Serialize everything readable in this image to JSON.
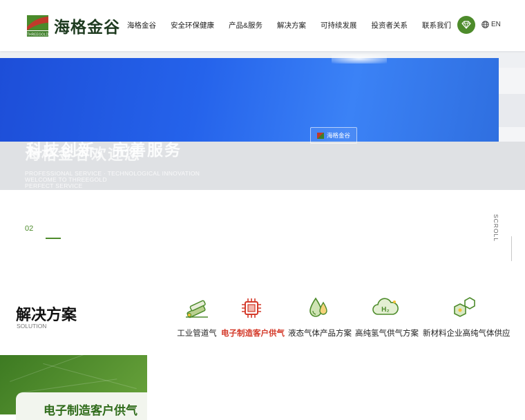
{
  "brand": {
    "name": "海格金谷",
    "logo_tagline": "THREEGOLD",
    "colors": {
      "primary_green": "#4d8b2b",
      "accent_red": "#d43a2a",
      "dark_text": "#1d3a1f"
    }
  },
  "nav": {
    "items": [
      {
        "label": "海格金谷"
      },
      {
        "label": "安全环保健康"
      },
      {
        "label": "产品&服务"
      },
      {
        "label": "解决方案"
      },
      {
        "label": "可持续发展"
      },
      {
        "label": "投资者关系"
      },
      {
        "label": "联系我们"
      }
    ],
    "language": "EN",
    "icons": [
      "diamond-icon",
      "globe-icon"
    ]
  },
  "banner": {
    "title_a": "科技创新，完善服务",
    "title_b": "海格金谷欢迎您",
    "sub_a": "PROFESSIONAL SERVICE · TECHNOLOGICAL INNOVATION",
    "sub_b": "WELCOME TO THREEGOLD",
    "sub_c": "PERFECT SERVICE",
    "badge": "海格金谷"
  },
  "slider": {
    "current": "02",
    "scroll_label": "SCROLL"
  },
  "solutions": {
    "title": "解决方案",
    "subtitle": "SOLUTION",
    "items": [
      {
        "label": "工业管道气",
        "icon": "pipeline-icon",
        "active": false
      },
      {
        "label": "电子制造客户供气",
        "icon": "chip-icon",
        "active": true
      },
      {
        "label": "液态气体产品方案",
        "icon": "liquid-drops-icon",
        "active": false
      },
      {
        "label": "高纯氢气供气方案",
        "icon": "h2-cloud-icon",
        "active": false
      },
      {
        "label": "新材料企业高纯气体供应",
        "icon": "molecule-icon",
        "active": false
      }
    ],
    "active_card_title": "电子制造客户供气"
  }
}
